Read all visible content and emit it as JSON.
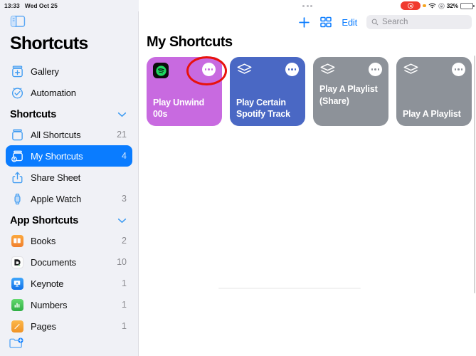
{
  "status_bar": {
    "time": "13:33",
    "date": "Wed Oct 25",
    "battery_percent": "32%",
    "recording_indicator": "screen-recording-pill",
    "icons": [
      "orange-dot-icon",
      "wifi-icon",
      "rotation-lock-icon",
      "battery-icon"
    ]
  },
  "sidebar": {
    "toggle_icon": "sidebar-toggle-icon",
    "title": "Shortcuts",
    "top_items": [
      {
        "label": "Gallery",
        "icon": "gallery-icon",
        "count": ""
      },
      {
        "label": "Automation",
        "icon": "automation-icon",
        "count": ""
      }
    ],
    "sections": [
      {
        "title": "Shortcuts",
        "collapse_icon": "chevron-down-icon",
        "items": [
          {
            "label": "All Shortcuts",
            "icon": "all-shortcuts-icon",
            "count": "21",
            "selected": false
          },
          {
            "label": "My Shortcuts",
            "icon": "my-shortcuts-icon",
            "count": "4",
            "selected": true
          },
          {
            "label": "Share Sheet",
            "icon": "share-sheet-icon",
            "count": "",
            "selected": false
          },
          {
            "label": "Apple Watch",
            "icon": "apple-watch-icon",
            "count": "3",
            "selected": false
          }
        ]
      },
      {
        "title": "App Shortcuts",
        "collapse_icon": "chevron-down-icon",
        "items": [
          {
            "label": "Books",
            "icon": "books-app-icon",
            "count": "2",
            "color": "#f5873a"
          },
          {
            "label": "Documents",
            "icon": "documents-app-icon",
            "count": "10",
            "color": "#f4f4f4"
          },
          {
            "label": "Keynote",
            "icon": "keynote-app-icon",
            "count": "1",
            "color": "#1f8ff5"
          },
          {
            "label": "Numbers",
            "icon": "numbers-app-icon",
            "count": "1",
            "color": "#43c352"
          },
          {
            "label": "Pages",
            "icon": "pages-app-icon",
            "count": "1",
            "color": "#f5a43a"
          }
        ]
      }
    ],
    "new_folder_icon": "new-folder-icon"
  },
  "toolbar": {
    "add_label": "+",
    "add_icon": "plus-icon",
    "layout_icon": "grid-layout-icon",
    "edit_label": "Edit",
    "search": {
      "placeholder": "Search",
      "value": "",
      "icon": "search-icon"
    }
  },
  "main": {
    "page_title": "My Shortcuts",
    "cards": [
      {
        "title": "Play Unwind 00s",
        "bg": "#c86ae0",
        "app_icon": "spotify-icon",
        "ellipsis": "ellipsis-icon",
        "ellipsis_color": "#c86ae0",
        "label_align": "bottom"
      },
      {
        "title": "Play Certain Spotify Track",
        "bg": "#4a68c4",
        "app_icon": "layers-icon",
        "ellipsis": "ellipsis-icon",
        "ellipsis_color": "#4a68c4",
        "label_align": "bottom"
      },
      {
        "title": "Play A Playlist (Share)",
        "bg": "#8d9299",
        "app_icon": "layers-icon",
        "ellipsis": "ellipsis-icon",
        "ellipsis_color": "#8d9299",
        "label_align": "top"
      },
      {
        "title": "Play A Playlist",
        "bg": "#8d9299",
        "app_icon": "layers-icon",
        "ellipsis": "ellipsis-icon",
        "ellipsis_color": "#8d9299",
        "label_align": "bottom"
      }
    ]
  },
  "annotation": {
    "shape": "red-ellipse-highlight",
    "color": "#e8120c",
    "target": "ellipsis-icon of Play Unwind 00s card"
  }
}
